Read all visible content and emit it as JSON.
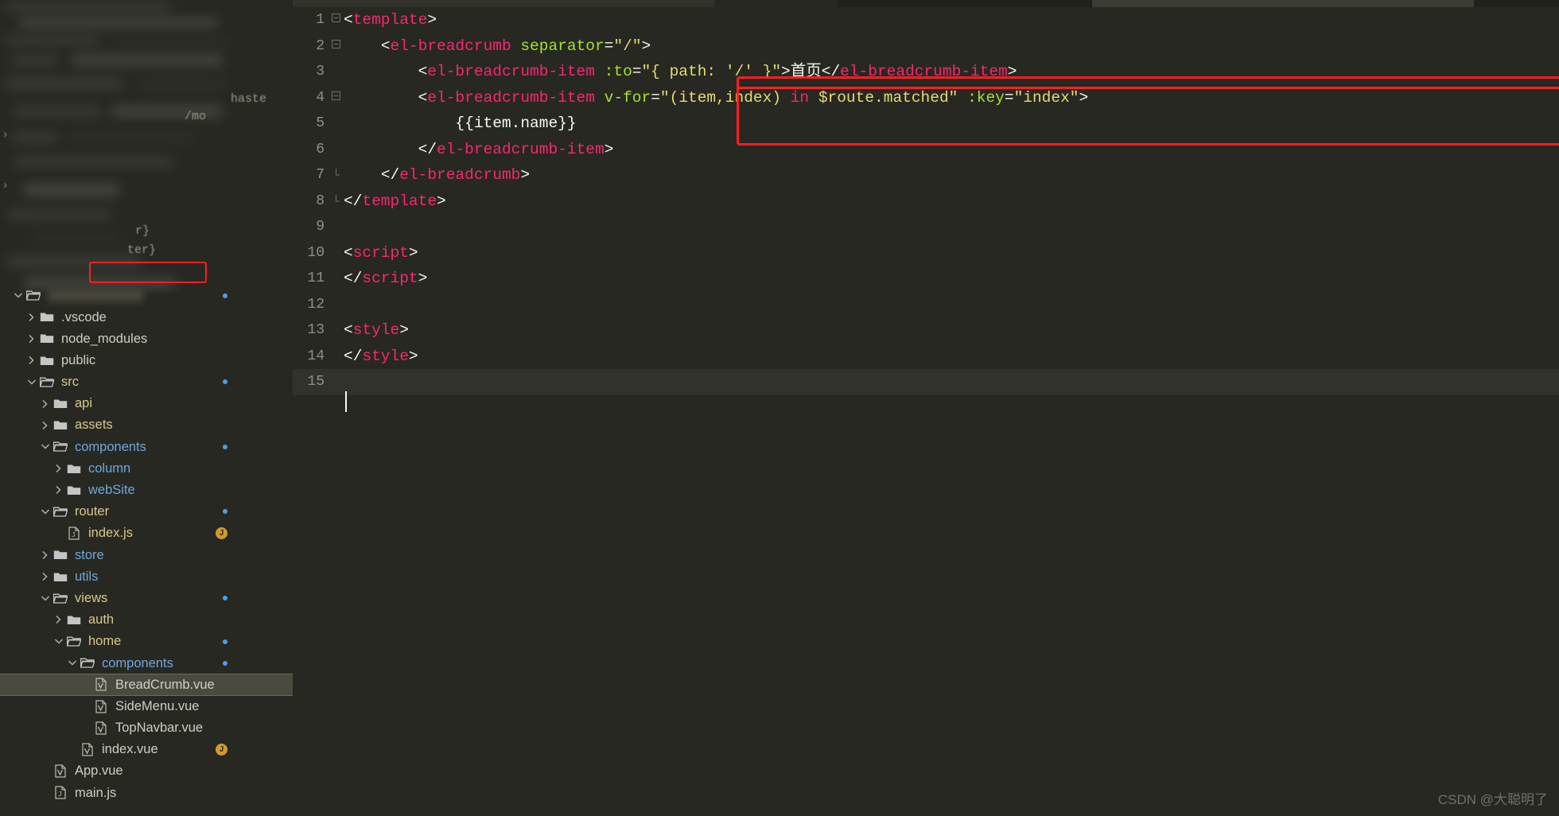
{
  "app": {
    "watermark": "CSDN @大聪明了"
  },
  "explorer": {
    "obscured_fragments": [
      "haste",
      "/mo",
      "r}",
      "ter}"
    ],
    "tree": [
      {
        "label": "",
        "type": "folder-open",
        "depth": 0,
        "color": "gold",
        "obscured": true,
        "dot": true
      },
      {
        "label": ".vscode",
        "type": "folder",
        "depth": 1,
        "color": "plain"
      },
      {
        "label": "node_modules",
        "type": "folder",
        "depth": 1,
        "color": "plain"
      },
      {
        "label": "public",
        "type": "folder",
        "depth": 1,
        "color": "plain"
      },
      {
        "label": "src",
        "type": "folder-open",
        "depth": 1,
        "color": "gold",
        "dot": true
      },
      {
        "label": "api",
        "type": "folder",
        "depth": 2,
        "color": "gold"
      },
      {
        "label": "assets",
        "type": "folder",
        "depth": 2,
        "color": "gold"
      },
      {
        "label": "components",
        "type": "folder-open",
        "depth": 2,
        "color": "blue",
        "dot": true
      },
      {
        "label": "column",
        "type": "folder",
        "depth": 3,
        "color": "blue"
      },
      {
        "label": "webSite",
        "type": "folder",
        "depth": 3,
        "color": "blue"
      },
      {
        "label": "router",
        "type": "folder-open",
        "depth": 2,
        "color": "gold",
        "dot": true
      },
      {
        "label": "index.js",
        "type": "file-js",
        "depth": 3,
        "color": "gold",
        "badge": "J"
      },
      {
        "label": "store",
        "type": "folder",
        "depth": 2,
        "color": "blue"
      },
      {
        "label": "utils",
        "type": "folder",
        "depth": 2,
        "color": "blue"
      },
      {
        "label": "views",
        "type": "folder-open",
        "depth": 2,
        "color": "gold",
        "dot": true
      },
      {
        "label": "auth",
        "type": "folder",
        "depth": 3,
        "color": "gold"
      },
      {
        "label": "home",
        "type": "folder-open",
        "depth": 3,
        "color": "gold",
        "dot": true
      },
      {
        "label": "components",
        "type": "folder-open",
        "depth": 4,
        "color": "blue",
        "dot": true
      },
      {
        "label": "BreadCrumb.vue",
        "type": "file-vue",
        "depth": 5,
        "color": "plain",
        "selected": true
      },
      {
        "label": "SideMenu.vue",
        "type": "file-vue",
        "depth": 5,
        "color": "plain"
      },
      {
        "label": "TopNavbar.vue",
        "type": "file-vue",
        "depth": 5,
        "color": "plain"
      },
      {
        "label": "index.vue",
        "type": "file-vue",
        "depth": 4,
        "color": "plain",
        "badge": "J"
      },
      {
        "label": "App.vue",
        "type": "file-vue",
        "depth": 2,
        "color": "plain"
      },
      {
        "label": "main.js",
        "type": "file-js",
        "depth": 2,
        "color": "plain"
      }
    ]
  },
  "editor": {
    "lines": [
      {
        "n": "1",
        "fold": "minus",
        "tokens": [
          {
            "t": "punc",
            "v": "<"
          },
          {
            "t": "tag",
            "v": "template"
          },
          {
            "t": "punc",
            "v": ">"
          }
        ]
      },
      {
        "n": "2",
        "fold": "minus",
        "tokens": [
          {
            "t": "plain",
            "v": "    "
          },
          {
            "t": "punc",
            "v": "<"
          },
          {
            "t": "tag",
            "v": "el-breadcrumb"
          },
          {
            "t": "plain",
            "v": " "
          },
          {
            "t": "attr",
            "v": "separator"
          },
          {
            "t": "punc",
            "v": "="
          },
          {
            "t": "str",
            "v": "\"/\""
          },
          {
            "t": "punc",
            "v": ">"
          }
        ]
      },
      {
        "n": "3",
        "fold": "",
        "tokens": [
          {
            "t": "plain",
            "v": "        "
          },
          {
            "t": "punc",
            "v": "<"
          },
          {
            "t": "tag",
            "v": "el-breadcrumb-item"
          },
          {
            "t": "plain",
            "v": " "
          },
          {
            "t": "attr",
            "v": ":to"
          },
          {
            "t": "punc",
            "v": "="
          },
          {
            "t": "str",
            "v": "\"{ path: "
          },
          {
            "t": "str2",
            "v": "'/'"
          },
          {
            "t": "str",
            "v": " }\""
          },
          {
            "t": "punc",
            "v": ">"
          },
          {
            "t": "plain",
            "v": "首页"
          },
          {
            "t": "punc",
            "v": "</"
          },
          {
            "t": "tag",
            "v": "el-breadcrumb-item"
          },
          {
            "t": "punc",
            "v": ">"
          }
        ]
      },
      {
        "n": "4",
        "fold": "minus",
        "tokens": [
          {
            "t": "plain",
            "v": "        "
          },
          {
            "t": "punc",
            "v": "<"
          },
          {
            "t": "tag",
            "v": "el-breadcrumb-item"
          },
          {
            "t": "plain",
            "v": " "
          },
          {
            "t": "attr",
            "v": "v-for"
          },
          {
            "t": "punc",
            "v": "="
          },
          {
            "t": "str",
            "v": "\"(item,index) "
          },
          {
            "t": "kw",
            "v": "in"
          },
          {
            "t": "str",
            "v": " $route.matched\""
          },
          {
            "t": "plain",
            "v": " "
          },
          {
            "t": "attr",
            "v": ":key"
          },
          {
            "t": "punc",
            "v": "="
          },
          {
            "t": "str",
            "v": "\"index\""
          },
          {
            "t": "punc",
            "v": ">"
          }
        ]
      },
      {
        "n": "5",
        "fold": "",
        "tokens": [
          {
            "t": "plain",
            "v": "            {{item.name}}"
          }
        ]
      },
      {
        "n": "6",
        "fold": "",
        "tokens": [
          {
            "t": "plain",
            "v": "        "
          },
          {
            "t": "punc",
            "v": "</"
          },
          {
            "t": "tag",
            "v": "el-breadcrumb-item"
          },
          {
            "t": "punc",
            "v": ">"
          }
        ]
      },
      {
        "n": "7",
        "fold": "end",
        "tokens": [
          {
            "t": "plain",
            "v": "    "
          },
          {
            "t": "punc",
            "v": "</"
          },
          {
            "t": "tag",
            "v": "el-breadcrumb"
          },
          {
            "t": "punc",
            "v": ">"
          }
        ]
      },
      {
        "n": "8",
        "fold": "end",
        "tokens": [
          {
            "t": "punc",
            "v": "</"
          },
          {
            "t": "tag",
            "v": "template"
          },
          {
            "t": "punc",
            "v": ">"
          }
        ]
      },
      {
        "n": "9",
        "fold": "",
        "tokens": []
      },
      {
        "n": "10",
        "fold": "",
        "tokens": [
          {
            "t": "punc",
            "v": "<"
          },
          {
            "t": "tag",
            "v": "script"
          },
          {
            "t": "punc",
            "v": ">"
          }
        ]
      },
      {
        "n": "11",
        "fold": "",
        "tokens": [
          {
            "t": "punc",
            "v": "</"
          },
          {
            "t": "tag",
            "v": "script"
          },
          {
            "t": "punc",
            "v": ">"
          }
        ]
      },
      {
        "n": "12",
        "fold": "",
        "tokens": []
      },
      {
        "n": "13",
        "fold": "",
        "tokens": [
          {
            "t": "punc",
            "v": "<"
          },
          {
            "t": "tag",
            "v": "style"
          },
          {
            "t": "punc",
            "v": ">"
          }
        ]
      },
      {
        "n": "14",
        "fold": "",
        "tokens": [
          {
            "t": "punc",
            "v": "</"
          },
          {
            "t": "tag",
            "v": "style"
          },
          {
            "t": "punc",
            "v": ">"
          }
        ]
      },
      {
        "n": "15",
        "fold": "",
        "tokens": [],
        "current": true
      }
    ]
  }
}
